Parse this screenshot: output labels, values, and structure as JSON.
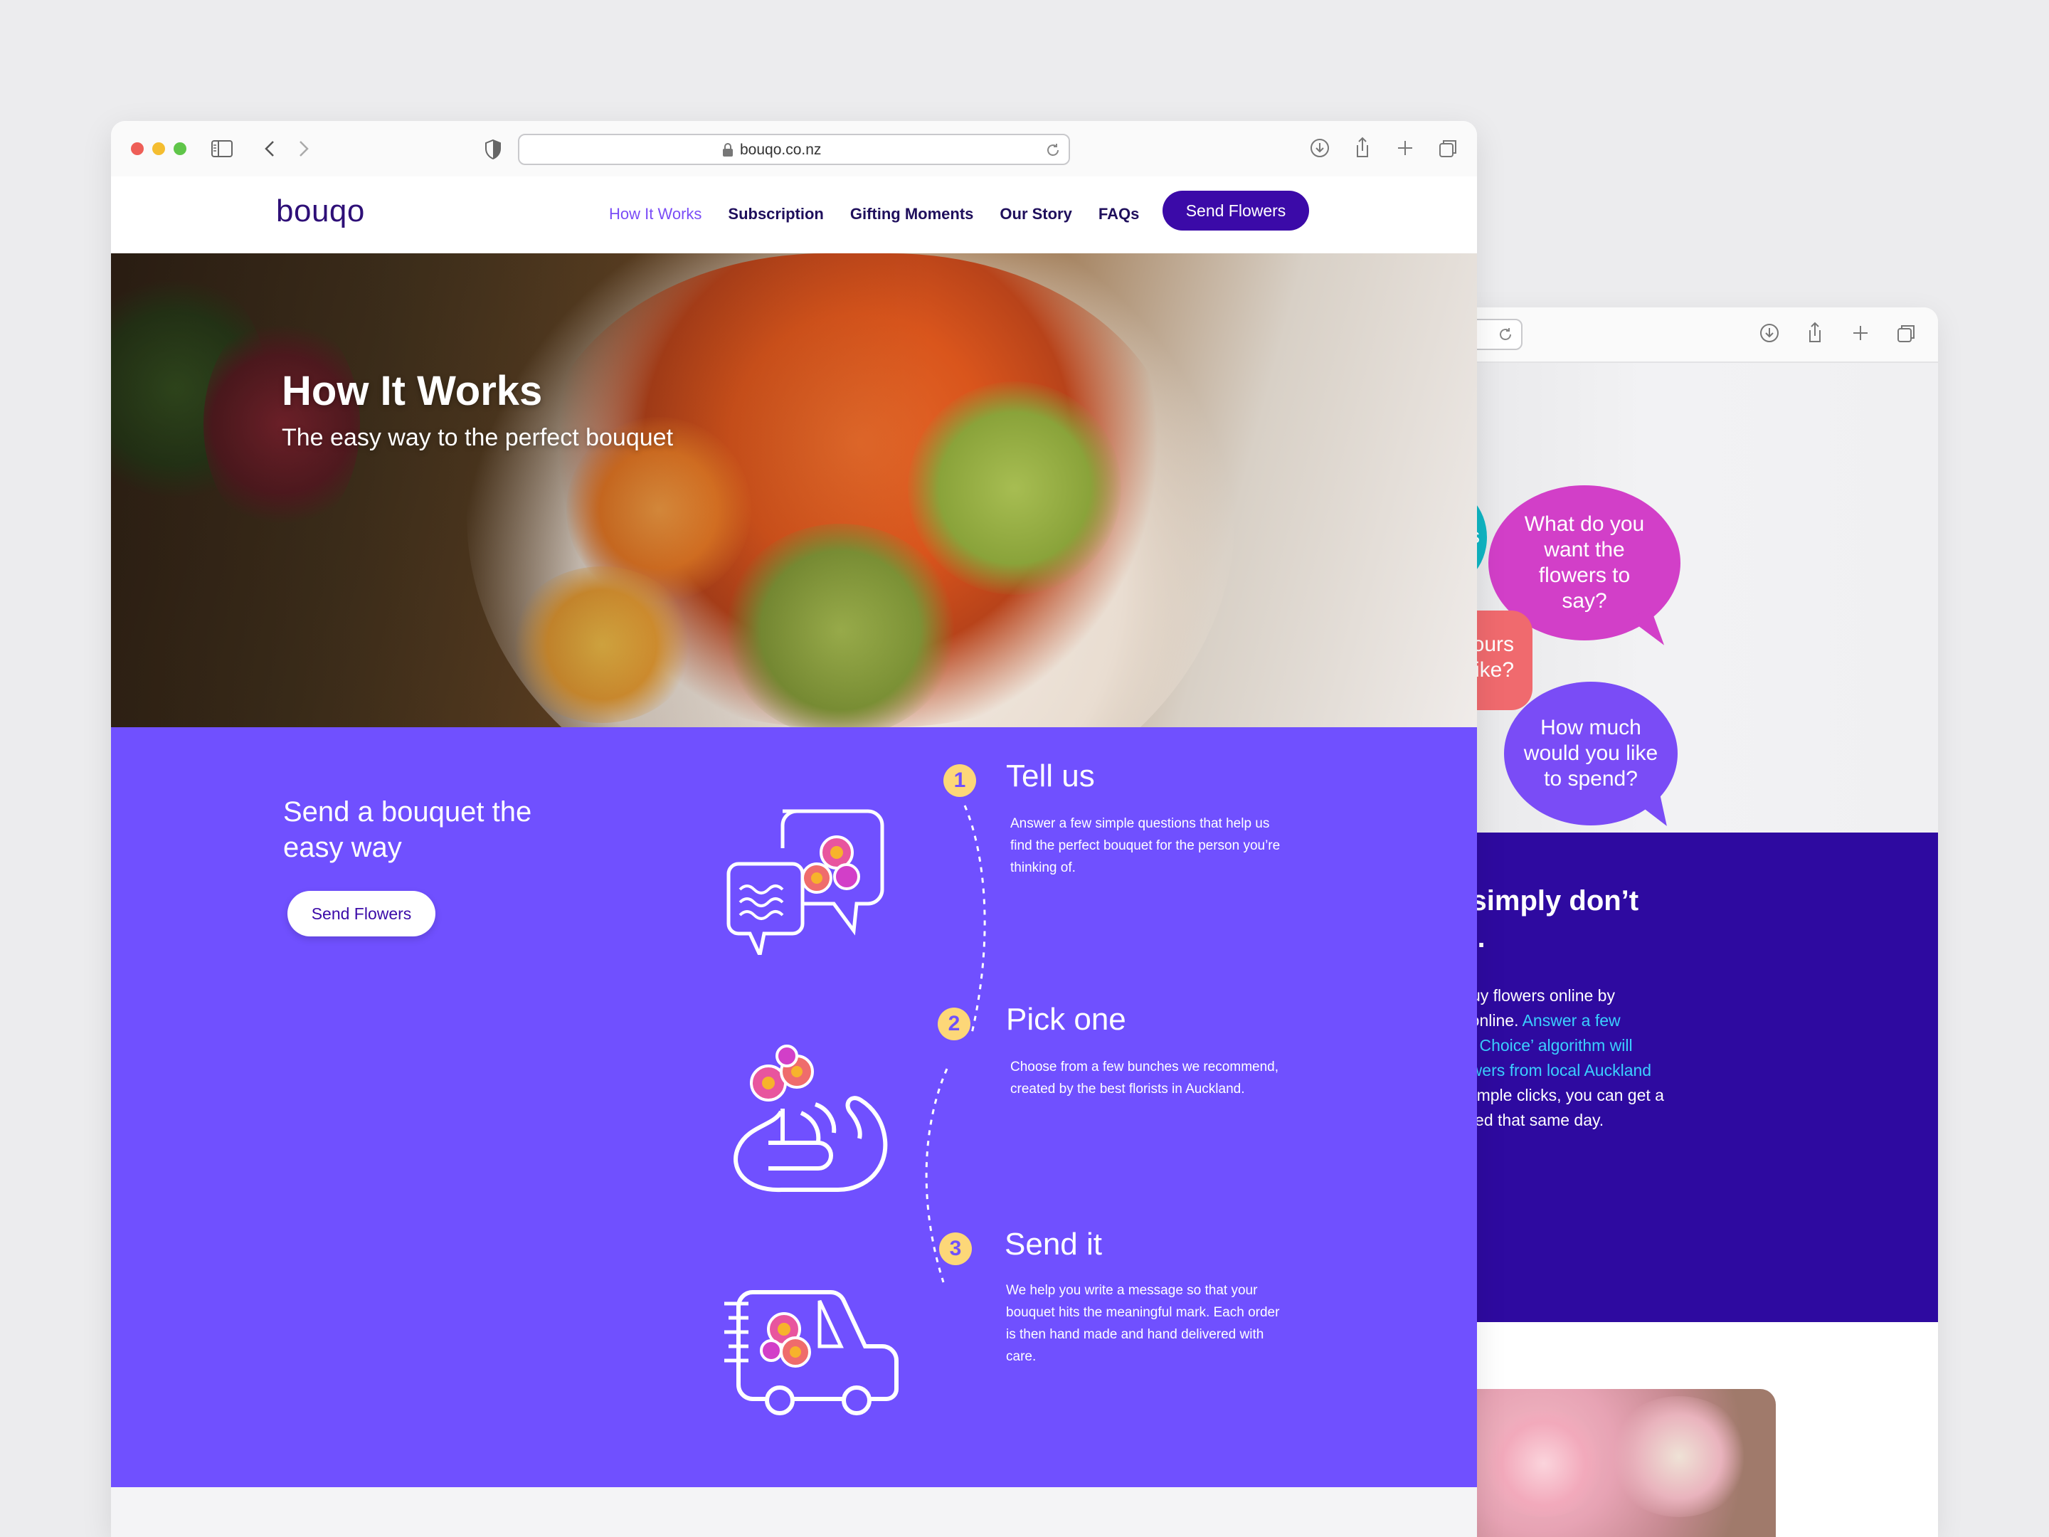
{
  "front": {
    "url": "bouqo.co.nz",
    "logo": "bouqo",
    "nav": [
      "How It Works",
      "Subscription",
      "Gifting Moments",
      "Our Story",
      "FAQs"
    ],
    "cta": "Send Flowers",
    "hero": {
      "title": "How It Works",
      "subtitle": "The easy way to the perfect bouquet"
    },
    "lead": {
      "text": "Send a bouquet the easy way",
      "button": "Send Flowers"
    },
    "steps": [
      {
        "num": "1",
        "title": "Tell us",
        "desc": "Answer a few simple questions that help us find the perfect bouquet for the person you’re thinking of.",
        "icon": "chat-bubbles-icon"
      },
      {
        "num": "2",
        "title": "Pick one",
        "desc": "Choose from a few bunches we recommend, created by the best florists in Auckland.",
        "icon": "hand-flower-icon"
      },
      {
        "num": "3",
        "title": "Send it",
        "desc": "We help you write a message so that your bouquet hits the meaningful mark. Each order is then hand made and hand delivered with care.",
        "icon": "delivery-van-icon"
      }
    ]
  },
  "back": {
    "bubbles": {
      "teal": "s",
      "pink": "What do you want the flowers to say?",
      "coral": "olours\ney like?",
      "violet": "How much would you like to spend?"
    },
    "heading": "u simply don’t\nce.",
    "para_1": "o buy flowers online by\nce online. ",
    "para_link": "Answer a few\nfect Choice’ algorithm will\n flowers from local Auckland",
    "para_2": "\nw simple clicks, you can get a\nivered that same day."
  },
  "colors": {
    "brand_dark": "#3b0aa8",
    "brand_purple": "#7050ff",
    "step_badge": "#fdd778",
    "link": "#3bd0ff"
  }
}
